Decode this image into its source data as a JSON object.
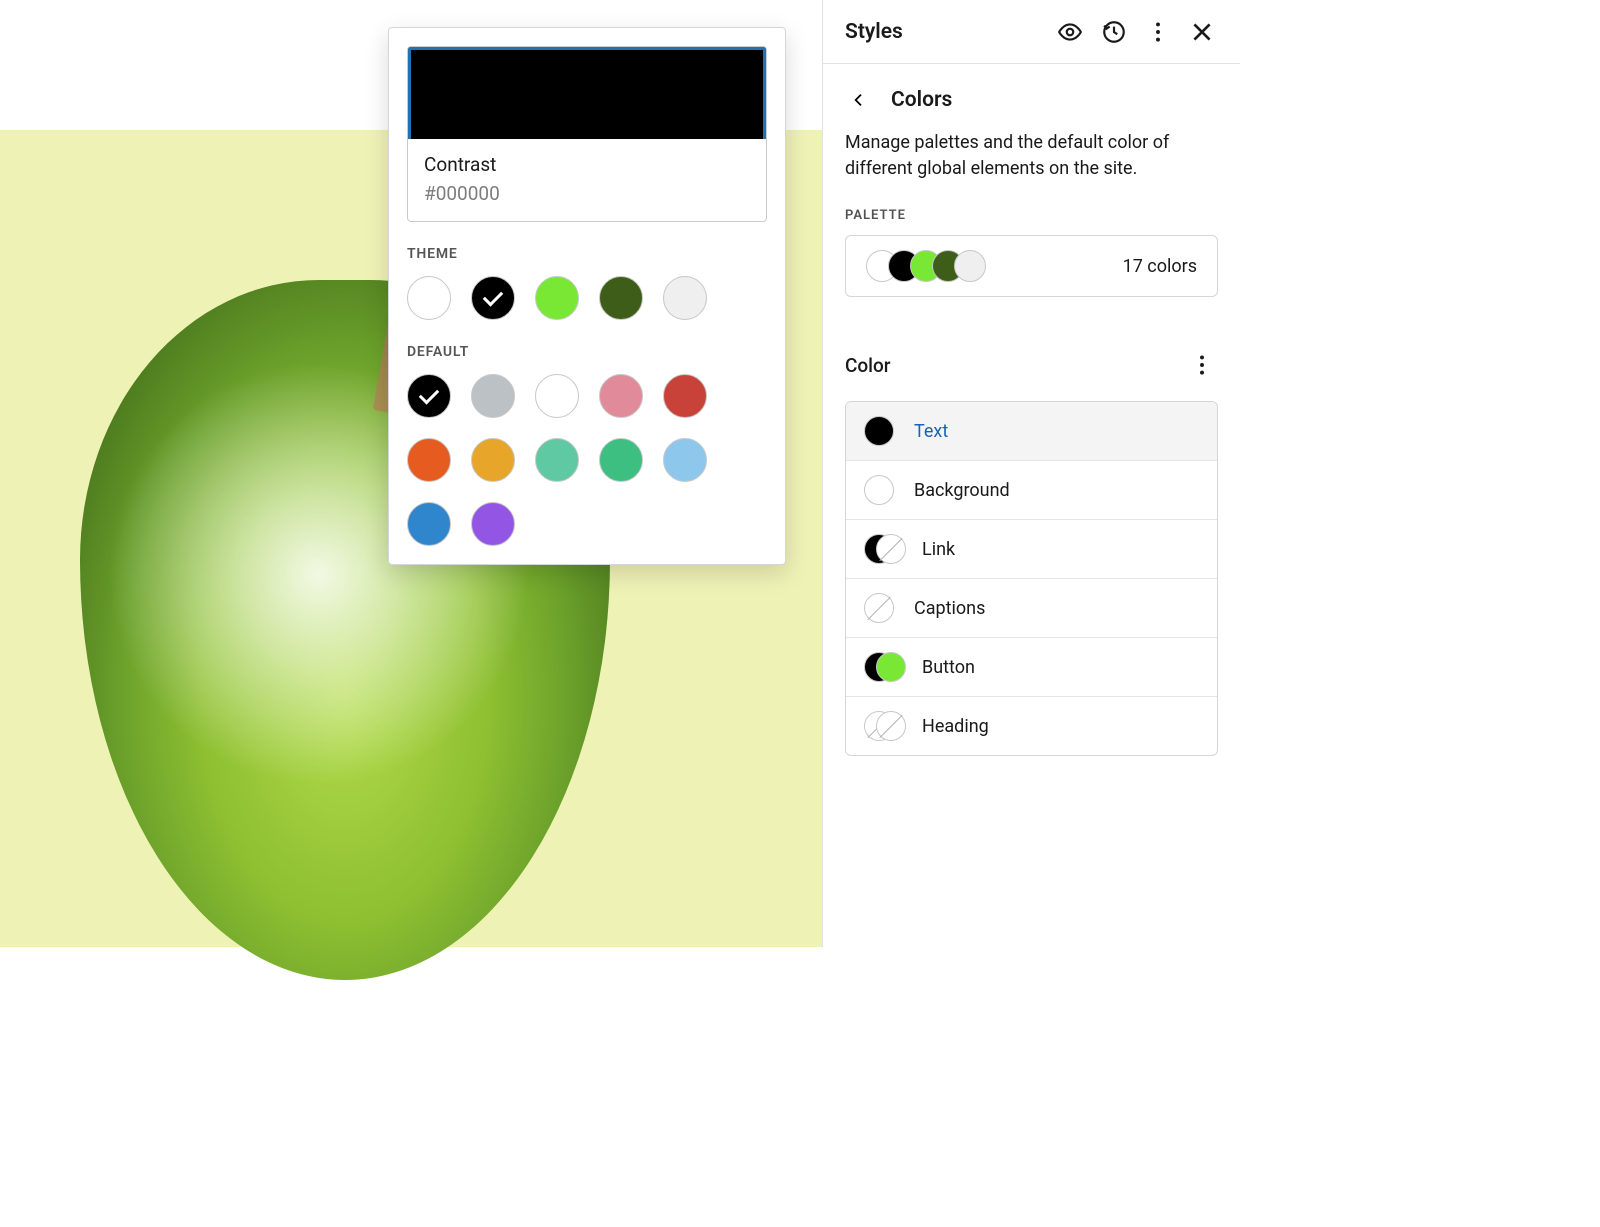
{
  "popover": {
    "selected_name": "Contrast",
    "selected_hex": "#000000",
    "theme_label": "THEME",
    "default_label": "DEFAULT",
    "theme_swatches": [
      {
        "hex": "#ffffff",
        "selected": false
      },
      {
        "hex": "#000000",
        "selected": true
      },
      {
        "hex": "#79e834",
        "selected": false
      },
      {
        "hex": "#3e5d18",
        "selected": false
      },
      {
        "hex": "#efefef",
        "selected": false
      }
    ],
    "default_swatches": [
      {
        "hex": "#000000",
        "selected": true
      },
      {
        "hex": "#bcc1c6",
        "selected": false
      },
      {
        "hex": "#ffffff",
        "selected": false
      },
      {
        "hex": "#e08a9a",
        "selected": false
      },
      {
        "hex": "#c9423a",
        "selected": false
      },
      {
        "hex": "#e65b1f",
        "selected": false
      },
      {
        "hex": "#e7a52a",
        "selected": false
      },
      {
        "hex": "#5ec9a3",
        "selected": false
      },
      {
        "hex": "#3cbf80",
        "selected": false
      },
      {
        "hex": "#8ec7ec",
        "selected": false
      },
      {
        "hex": "#2f86cc",
        "selected": false
      },
      {
        "hex": "#9356e4",
        "selected": false
      }
    ]
  },
  "sidebar": {
    "title": "Styles",
    "subheading": "Colors",
    "description": "Manage palettes and the default color of different global elements on the site.",
    "palette_label": "PALETTE",
    "palette_dots": [
      "#ffffff",
      "#000000",
      "#79e834",
      "#3e5d18",
      "#efefef"
    ],
    "palette_count": "17 colors",
    "color_heading": "Color",
    "items": [
      {
        "label": "Text",
        "type": "single",
        "colors": [
          "#000000"
        ],
        "selected": true
      },
      {
        "label": "Background",
        "type": "single",
        "colors": [
          "#ffffff"
        ],
        "selected": false
      },
      {
        "label": "Link",
        "type": "duo",
        "colors": [
          "#000000",
          null
        ],
        "selected": false
      },
      {
        "label": "Captions",
        "type": "empty",
        "colors": [
          null
        ],
        "selected": false
      },
      {
        "label": "Button",
        "type": "duo",
        "colors": [
          "#000000",
          "#79e834"
        ],
        "selected": false
      },
      {
        "label": "Heading",
        "type": "duo",
        "colors": [
          null,
          null
        ],
        "selected": false
      }
    ]
  }
}
